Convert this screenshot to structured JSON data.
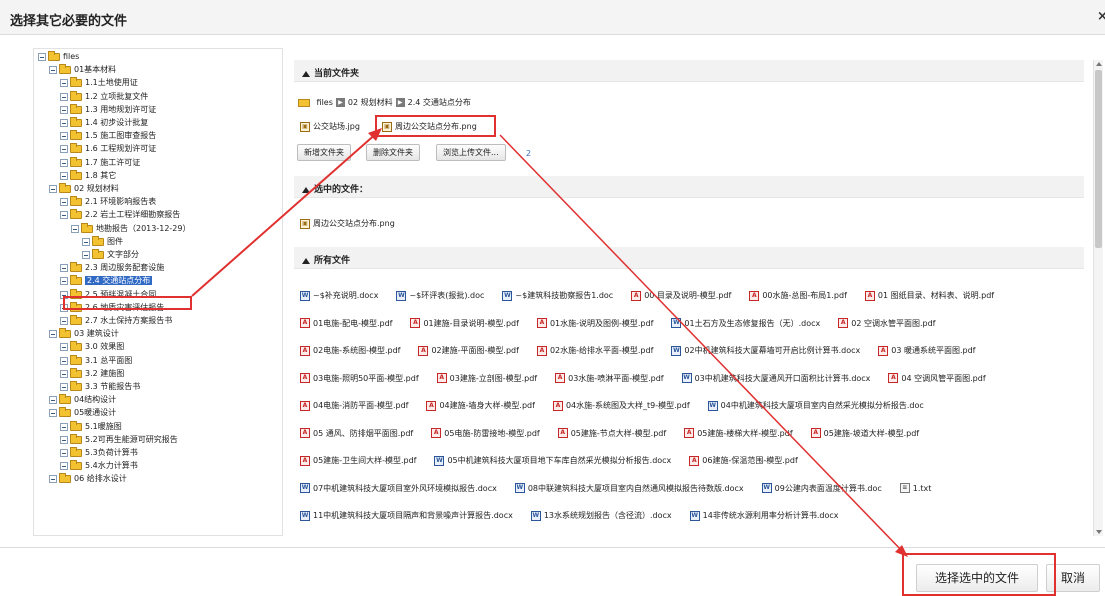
{
  "dialog": {
    "title": "选择其它必要的文件",
    "close": "×"
  },
  "tree": [
    {
      "label": "files",
      "depth": 0
    },
    {
      "label": "01基本材料",
      "depth": 1
    },
    {
      "label": "1.1土地使用证",
      "depth": 2
    },
    {
      "label": "1.2 立项批复文件",
      "depth": 2
    },
    {
      "label": "1.3 用地规划许可证",
      "depth": 2
    },
    {
      "label": "1.4 初步设计批复",
      "depth": 2
    },
    {
      "label": "1.5 施工图审查报告",
      "depth": 2
    },
    {
      "label": "1.6 工程规划许可证",
      "depth": 2
    },
    {
      "label": "1.7 施工许可证",
      "depth": 2
    },
    {
      "label": "1.8 其它",
      "depth": 2
    },
    {
      "label": "02 规划材料",
      "depth": 1
    },
    {
      "label": "2.1 环境影响报告表",
      "depth": 2
    },
    {
      "label": "2.2 岩土工程详细勘察报告",
      "depth": 2
    },
    {
      "label": "地勘报告（2013-12-29）",
      "depth": 3
    },
    {
      "label": "图件",
      "depth": 4
    },
    {
      "label": "文字部分",
      "depth": 4
    },
    {
      "label": "2.3 周边服务配套设施",
      "depth": 2
    },
    {
      "label": "2.4 交通站点分布",
      "depth": 2,
      "selected": true
    },
    {
      "label": "2.5 预拌混凝土合同",
      "depth": 2
    },
    {
      "label": "2.6 地质灾害评估报告",
      "depth": 2
    },
    {
      "label": "2.7 水土保持方案报告书",
      "depth": 2
    },
    {
      "label": "03 建筑设计",
      "depth": 1
    },
    {
      "label": "3.0 效果图",
      "depth": 2
    },
    {
      "label": "3.1 总平面图",
      "depth": 2
    },
    {
      "label": "3.2 建施图",
      "depth": 2
    },
    {
      "label": "3.3 节能报告书",
      "depth": 2
    },
    {
      "label": "04结构设计",
      "depth": 1
    },
    {
      "label": "05暖通设计",
      "depth": 1
    },
    {
      "label": "5.1暖施图",
      "depth": 2
    },
    {
      "label": "5.2可再生能源可研究报告",
      "depth": 2
    },
    {
      "label": "5.3负荷计算书",
      "depth": 2
    },
    {
      "label": "5.4水力计算书",
      "depth": 2
    },
    {
      "label": "06 给排水设计",
      "depth": 1
    }
  ],
  "current_folder": {
    "heading": "当前文件夹",
    "breadcrumb": [
      "files",
      "02 规划材料",
      "2.4 交通站点分布"
    ],
    "files": [
      {
        "name": "公交站场.jpg",
        "icon": "image-icon"
      },
      {
        "name": "周边公交站点分布.png",
        "icon": "image-icon"
      }
    ],
    "buttons": {
      "new_folder": "新增文件夹",
      "delete_folder": "删除文件夹",
      "browse_upload": "浏览上传文件..."
    },
    "stray": "2"
  },
  "selected_files": {
    "heading": "选中的文件：",
    "files": [
      {
        "name": "周边公交站点分布.png",
        "icon": "image-icon"
      }
    ]
  },
  "all_files": {
    "heading": "所有文件",
    "rows": [
      [
        {
          "name": "~$补充说明.docx",
          "icon": "word-icon"
        },
        {
          "name": "~$环评表(报批).doc",
          "icon": "word-icon"
        },
        {
          "name": "~$建筑科技勘察报告1.doc",
          "icon": "word-icon"
        },
        {
          "name": "00 目录及说明-模型.pdf",
          "icon": "pdf-icon"
        },
        {
          "name": "00水施-总图-布局1.pdf",
          "icon": "pdf-icon"
        },
        {
          "name": "01 图纸目录、材料表、说明.pdf",
          "icon": "pdf-icon"
        }
      ],
      [
        {
          "name": "01电施-配电-模型.pdf",
          "icon": "pdf-icon"
        },
        {
          "name": "01建施-目录说明-模型.pdf",
          "icon": "pdf-icon"
        },
        {
          "name": "01水施-说明及图例-模型.pdf",
          "icon": "pdf-icon"
        },
        {
          "name": "01土石方及生态修复报告（无）.docx",
          "icon": "word-icon"
        },
        {
          "name": "02 空调水管平面图.pdf",
          "icon": "pdf-icon"
        }
      ],
      [
        {
          "name": "02电施-系统图-模型.pdf",
          "icon": "pdf-icon"
        },
        {
          "name": "02建施-平面图-模型.pdf",
          "icon": "pdf-icon"
        },
        {
          "name": "02水施-给排水平面-模型.pdf",
          "icon": "pdf-icon"
        },
        {
          "name": "02中机建筑科技大厦幕墙可开启比例计算书.docx",
          "icon": "word-icon"
        },
        {
          "name": "03 暖通系统平面图.pdf",
          "icon": "pdf-icon"
        }
      ],
      [
        {
          "name": "03电施-照明50平面-模型.pdf",
          "icon": "pdf-icon"
        },
        {
          "name": "03建施-立剖图-模型.pdf",
          "icon": "pdf-icon"
        },
        {
          "name": "03水施-喷淋平面-模型.pdf",
          "icon": "pdf-icon"
        },
        {
          "name": "03中机建筑科技大厦通风开口面积比计算书.docx",
          "icon": "word-icon"
        },
        {
          "name": "04 空调风管平面图.pdf",
          "icon": "pdf-icon"
        }
      ],
      [
        {
          "name": "04电施-消防平面-模型.pdf",
          "icon": "pdf-icon"
        },
        {
          "name": "04建施-墙身大样-模型.pdf",
          "icon": "pdf-icon"
        },
        {
          "name": "04水施-系统图及大样_t9-模型.pdf",
          "icon": "pdf-icon"
        },
        {
          "name": "04中机建筑科技大厦项目室内自然采光模拟分析报告.doc",
          "icon": "word-icon"
        }
      ],
      [
        {
          "name": "05 通风、防排烟平面图.pdf",
          "icon": "pdf-icon"
        },
        {
          "name": "05电施-防雷接地-模型.pdf",
          "icon": "pdf-icon"
        },
        {
          "name": "05建施-节点大样-模型.pdf",
          "icon": "pdf-icon"
        },
        {
          "name": "05建施-楼梯大样-模型.pdf",
          "icon": "pdf-icon"
        },
        {
          "name": "05建施-坡道大样-模型.pdf",
          "icon": "pdf-icon"
        }
      ],
      [
        {
          "name": "05建施-卫生间大样-模型.pdf",
          "icon": "pdf-icon"
        },
        {
          "name": "05中机建筑科技大厦项目地下车库自然采光模拟分析报告.docx",
          "icon": "word-icon"
        },
        {
          "name": "06建施-保温范围-模型.pdf",
          "icon": "pdf-icon"
        }
      ],
      [
        {
          "name": "07中机建筑科技大厦项目室外风环境模拟报告.docx",
          "icon": "word-icon"
        },
        {
          "name": "08中联建筑科技大厦项目室内自然通风模拟报告待数版.docx",
          "icon": "word-icon"
        },
        {
          "name": "09公建内表面温度计算书.doc",
          "icon": "word-icon"
        },
        {
          "name": "1.txt",
          "icon": "text-icon"
        }
      ],
      [
        {
          "name": "11中机建筑科技大厦项目隔声和背景噪声计算报告.docx",
          "icon": "word-icon"
        },
        {
          "name": "13水系统规划报告（含径流）.docx",
          "icon": "word-icon"
        },
        {
          "name": "14非传统水源利用率分析计算书.docx",
          "icon": "word-icon"
        }
      ]
    ]
  },
  "footer": {
    "confirm": "选择选中的文件",
    "cancel": "取消"
  },
  "colors": {
    "highlight": "#e03030",
    "selection": "#316ac5",
    "folder": "#f2c230",
    "pdf": "#c62828",
    "word": "#2b579a"
  }
}
